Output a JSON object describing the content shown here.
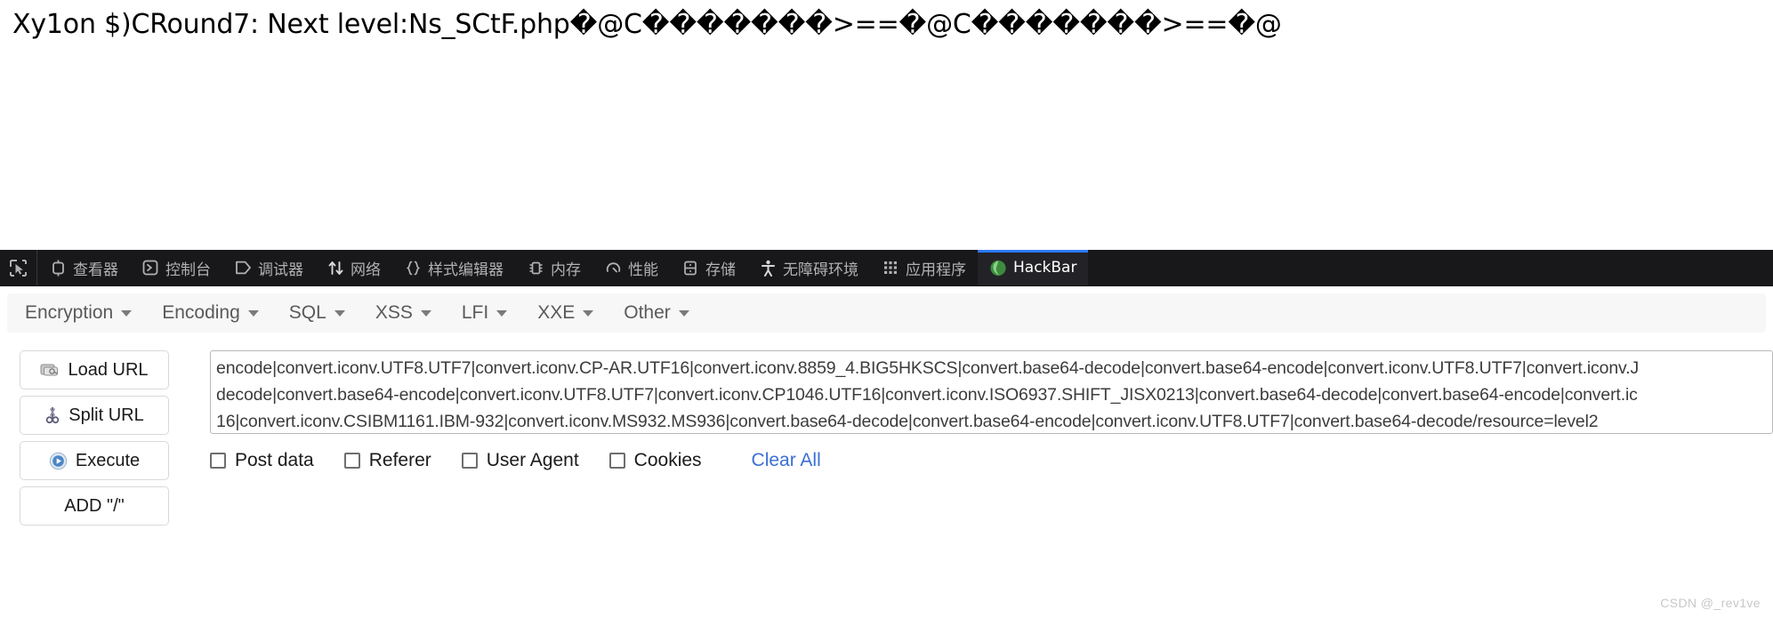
{
  "page": {
    "title_text": "Xy1on $)CRound7: Next level:Ns_SCtF.php�@C�������>==�@C�������>==�@"
  },
  "devtools": {
    "picker": {
      "name": "element-picker",
      "icon": "cursor-picker-icon"
    },
    "tabs": [
      {
        "label": "查看器",
        "icon": "inspector-icon",
        "active": false
      },
      {
        "label": "控制台",
        "icon": "console-icon",
        "active": false
      },
      {
        "label": "调试器",
        "icon": "debugger-icon",
        "active": false
      },
      {
        "label": "网络",
        "icon": "network-icon",
        "active": false
      },
      {
        "label": "样式编辑器",
        "icon": "style-editor-icon",
        "active": false
      },
      {
        "label": "内存",
        "icon": "memory-icon",
        "active": false
      },
      {
        "label": "性能",
        "icon": "performance-icon",
        "active": false
      },
      {
        "label": "存储",
        "icon": "storage-icon",
        "active": false
      },
      {
        "label": "无障碍环境",
        "icon": "accessibility-icon",
        "active": false
      },
      {
        "label": "应用程序",
        "icon": "application-icon",
        "active": false
      },
      {
        "label": "HackBar",
        "icon": "hackbar-firefox-icon",
        "active": true
      }
    ],
    "active_tab_indicator_color": "#2b79ff",
    "toolbar_background": "#18181a"
  },
  "hackbar": {
    "menu": [
      {
        "label": "Encryption"
      },
      {
        "label": "Encoding"
      },
      {
        "label": "SQL"
      },
      {
        "label": "XSS"
      },
      {
        "label": "LFI"
      },
      {
        "label": "XXE"
      },
      {
        "label": "Other"
      }
    ],
    "buttons": [
      {
        "label": "Load URL",
        "icon": "load-url-icon"
      },
      {
        "label": "Split URL",
        "icon": "scissors-icon"
      },
      {
        "label": "Execute",
        "icon": "play-icon"
      },
      {
        "label": "ADD \"/\"",
        "icon": "none"
      }
    ],
    "url_field": {
      "lines": [
        "encode|convert.iconv.UTF8.UTF7|convert.iconv.CP-AR.UTF16|convert.iconv.8859_4.BIG5HKSCS|convert.base64-decode|convert.base64-encode|convert.iconv.UTF8.UTF7|convert.iconv.J",
        "decode|convert.base64-encode|convert.iconv.UTF8.UTF7|convert.iconv.CP1046.UTF16|convert.iconv.ISO6937.SHIFT_JISX0213|convert.base64-decode|convert.base64-encode|convert.ic",
        "16|convert.iconv.CSIBM1161.IBM-932|convert.iconv.MS932.MS936|convert.base64-decode|convert.base64-encode|convert.iconv.UTF8.UTF7|convert.base64-decode/resource=level2"
      ]
    },
    "options": [
      {
        "label": "Post data",
        "checked": false
      },
      {
        "label": "Referer",
        "checked": false
      },
      {
        "label": "User Agent",
        "checked": false
      },
      {
        "label": "Cookies",
        "checked": false
      }
    ],
    "clear_all_label": "Clear All",
    "clear_all_color": "#3b6fd4"
  },
  "watermark": {
    "text": "CSDN @_rev1ve"
  }
}
